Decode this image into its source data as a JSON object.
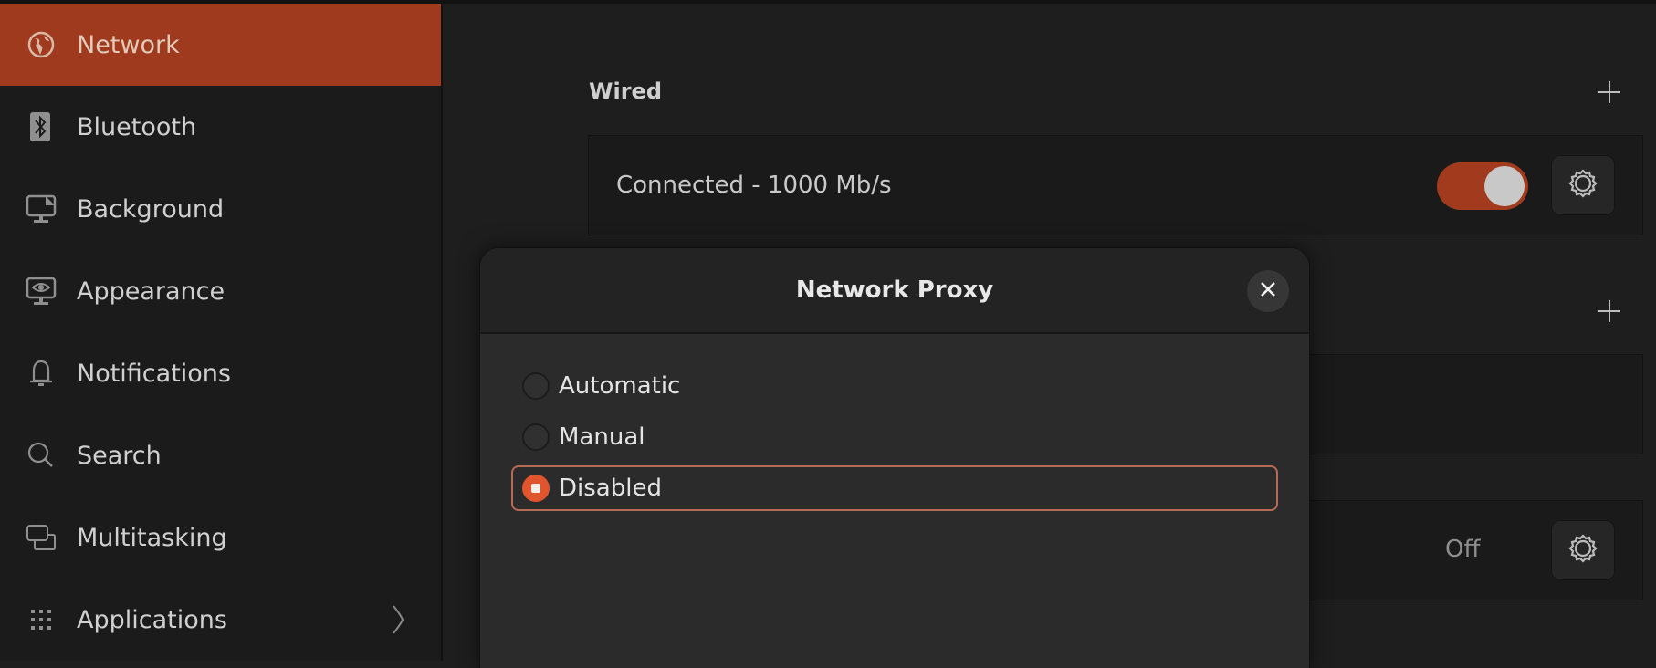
{
  "sidebar": {
    "items": [
      {
        "label": "Network",
        "icon": "globe-icon",
        "active": true
      },
      {
        "label": "Bluetooth",
        "icon": "bluetooth-icon",
        "active": false
      },
      {
        "label": "Background",
        "icon": "monitor-background-icon",
        "active": false
      },
      {
        "label": "Appearance",
        "icon": "monitor-eye-icon",
        "active": false
      },
      {
        "label": "Notifications",
        "icon": "bell-icon",
        "active": false
      },
      {
        "label": "Search",
        "icon": "search-icon",
        "active": false
      },
      {
        "label": "Multitasking",
        "icon": "multitasking-icon",
        "active": false
      },
      {
        "label": "Applications",
        "icon": "grid-icon",
        "active": false,
        "has_submenu": true
      }
    ]
  },
  "main": {
    "wired": {
      "title": "Wired",
      "add_icon": "plus-icon",
      "connection_status": "Connected - 1000 Mb/s",
      "toggle_on": true,
      "settings_icon": "gear-icon"
    },
    "section2": {
      "add_icon": "plus-icon"
    },
    "proxy_row": {
      "status": "Off",
      "settings_icon": "gear-icon"
    }
  },
  "dialog": {
    "title": "Network Proxy",
    "close_icon": "close-icon",
    "options": [
      {
        "label": "Automatic",
        "selected": false
      },
      {
        "label": "Manual",
        "selected": false
      },
      {
        "label": "Disabled",
        "selected": true
      }
    ]
  },
  "colors": {
    "accent": "#a03a1f",
    "radio_selected": "#e0542e",
    "focus_ring": "#b76a55"
  }
}
